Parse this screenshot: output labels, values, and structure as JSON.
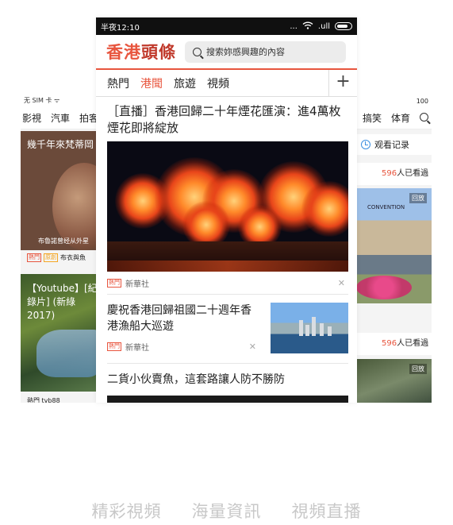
{
  "left_phone": {
    "status": "无 SIM 卡 ᯤ",
    "tabs": [
      "影視",
      "汽車",
      "拍客"
    ],
    "card1": {
      "title": "幾千年來梵蒂岡",
      "caption": "布魯諾曾经从外星"
    },
    "card1_meta": {
      "tag1": "熱門",
      "tag2": "原創",
      "source": "布衣與魚"
    },
    "card2": {
      "title": "【Youtube】[紀錄片] (新綠 2017)"
    },
    "card2_meta": {
      "text": "熱門 tvb88"
    }
  },
  "right_phone": {
    "status": "100",
    "tabs": [
      "搞笑",
      "体育"
    ],
    "history_label": "观看记录",
    "count1": {
      "number": "596",
      "suffix": "人已看過"
    },
    "count2": {
      "number": "596",
      "suffix": "人已看過"
    },
    "replay": "回放",
    "convention": "CONVENTION"
  },
  "phone": {
    "status": {
      "time": "半夜12:10",
      "dots": "...",
      "signal": ".ull"
    },
    "logo": {
      "part1": "香港",
      "part2": "頭條"
    },
    "search_placeholder": "搜索妳感興趣的內容",
    "tabs": [
      {
        "label": "熱門",
        "active": false
      },
      {
        "label": "港聞",
        "active": true
      },
      {
        "label": "旅遊",
        "active": false
      },
      {
        "label": "視頻",
        "active": false
      }
    ],
    "plus": "+",
    "articles": [
      {
        "title": "［直播］香港回歸二十年煙花匯演：進4萬枚煙花即將綻放",
        "tag": "熱門",
        "source": "新華社"
      },
      {
        "title": "慶祝香港回歸祖國二十週年香港漁船大巡遊",
        "tag": "熱門",
        "source": "新華社"
      },
      {
        "title": "二貨小伙賣魚，這套路讓人防不勝防"
      }
    ],
    "close_glyph": "✕"
  },
  "footer": [
    "精彩視頻",
    "海量資訊",
    "視頻直播"
  ],
  "colors": {
    "accent": "#e8553e",
    "status_bar": "#101010",
    "footer_text": "#c8c8c8"
  }
}
